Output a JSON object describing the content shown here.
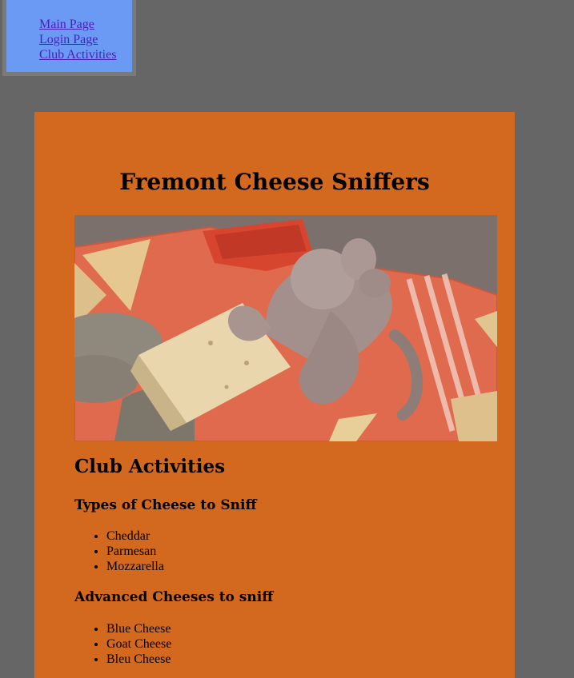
{
  "nav": {
    "links": [
      "Main Page",
      "Login Page",
      "Club Activities"
    ]
  },
  "header": {
    "title": "Fremont Cheese Sniffers"
  },
  "main": {
    "section_title": "Club Activities",
    "groups": [
      {
        "heading": "Types of Cheese to Sniff",
        "items": [
          "Cheddar",
          "Parmesan",
          "Mozzarella"
        ]
      },
      {
        "heading": "Advanced Cheeses to sniff",
        "items": [
          "Blue Cheese",
          "Goat Cheese",
          "Bleu Cheese"
        ]
      }
    ]
  },
  "colors": {
    "page_background": "#666666",
    "nav_background": "#6b9af5",
    "content_background": "#d2691e",
    "link": "#4a1fb8"
  }
}
